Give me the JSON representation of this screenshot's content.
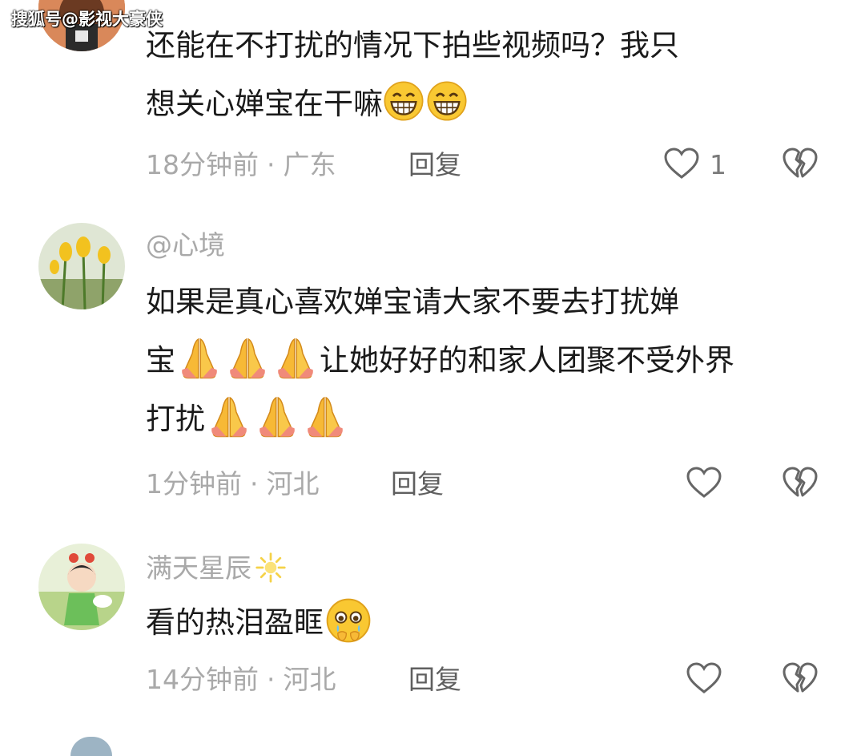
{
  "watermark": "搜狐号@影视大豪侠",
  "comments": [
    {
      "line1": "还能在不打扰的情况下拍些视频吗？我只",
      "line2": "想关心婵宝在干嘛",
      "time": "18分钟前",
      "location": "广东",
      "reply_label": "回复",
      "like_count": "1",
      "emojis": [
        "grinning-emoji",
        "grinning-emoji"
      ]
    },
    {
      "username": "@心境",
      "line1": "如果是真心喜欢婵宝请大家不要去打扰婵",
      "line2a": "宝",
      "line2b": "让她好好的和家人团聚不受外界",
      "line3": "打扰",
      "time": "1分钟前",
      "location": "河北",
      "reply_label": "回复",
      "emojis": [
        "folded-hands-emoji"
      ]
    },
    {
      "username": "满天星辰",
      "text": "看的热泪盈眶",
      "time": "14分钟前",
      "location": "河北",
      "reply_label": "回复",
      "emojis": [
        "sparkle-sun-emoji",
        "holding-back-tears-emoji"
      ]
    }
  ],
  "separator": "·",
  "colors": {
    "meta": "#a9a9a9",
    "text": "#1a1a1a",
    "emoji": "#f7c531"
  }
}
